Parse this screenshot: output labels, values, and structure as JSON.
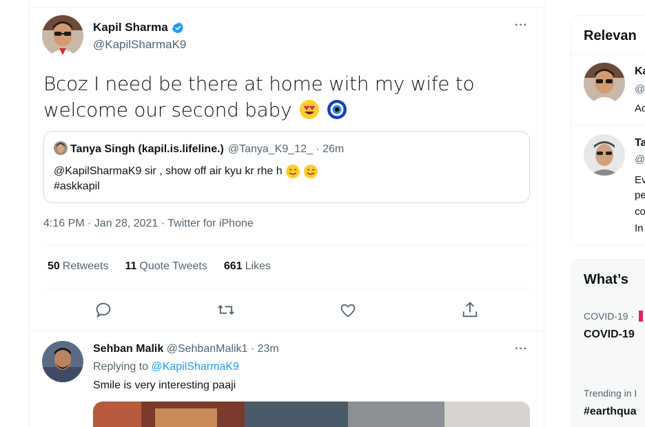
{
  "tweet": {
    "author_name": "Kapil Sharma",
    "author_handle": "@KapilSharmaK9",
    "text": "Bcoz I need be there at home with my wife to welcome our second baby",
    "timestamp": "4:16 PM · Jan 28, 2021 · Twitter for iPhone",
    "more": "···",
    "stats": [
      {
        "count": "50",
        "label": "Retweets"
      },
      {
        "count": "11",
        "label": "Quote Tweets"
      },
      {
        "count": "661",
        "label": "Likes"
      }
    ],
    "actions": [
      "reply-icon",
      "retweet-icon",
      "like-icon",
      "share-icon"
    ]
  },
  "quote": {
    "name": "Tanya Singh (kapil.is.lifeline.)",
    "handle_time": "@Tanya_K9_12_ · 26m",
    "line1": "@KapilSharmaK9 sir , show off air kyu kr rhe h",
    "line2": "#askkapil"
  },
  "reply": {
    "name": "Sehban Malik",
    "handle_time": "@SehbanMalik1 · 23m",
    "replying_prefix": "Replying to",
    "replying_handle": "@KapilSharmaK9",
    "text": "Smile is very interesting paaji",
    "more": "···"
  },
  "sidebar": {
    "relevant_title": "Relevan",
    "people": [
      {
        "name": "Ka",
        "handle": "@",
        "bio": "Ac"
      },
      {
        "name": "Ta",
        "handle": "@",
        "bio": [
          "Ev",
          "pe",
          "co",
          "In"
        ]
      }
    ],
    "whats_title": "What’s",
    "trend1_meta": "COVID-19 ·",
    "trend1_title": "COVID-19",
    "trend2_meta": "Trending in I",
    "trend2_title": "#earthqua"
  },
  "colors": {
    "accent": "#1d9bf0",
    "text": "#0f1419",
    "muted": "#536471"
  }
}
